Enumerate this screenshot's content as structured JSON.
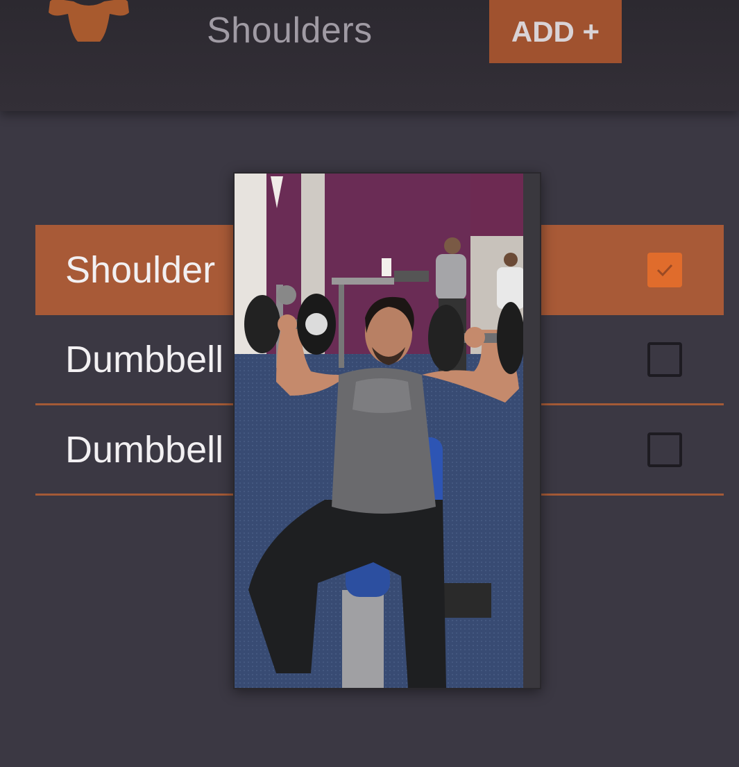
{
  "header": {
    "title": "Shoulders",
    "add_button_label": "ADD +",
    "logo_icon": "muscle-torso-icon"
  },
  "exercises": [
    {
      "label": "Shoulder",
      "checked": true
    },
    {
      "label": "Dumbbell",
      "checked": false
    },
    {
      "label": "Dumbbell",
      "checked": false
    }
  ],
  "popup": {
    "image_icon": "exercise-photo"
  },
  "colors": {
    "accent": "#a85a37",
    "checkbox_checked": "#e06c2c",
    "background": "#3b3843",
    "header": "#2c2930"
  }
}
